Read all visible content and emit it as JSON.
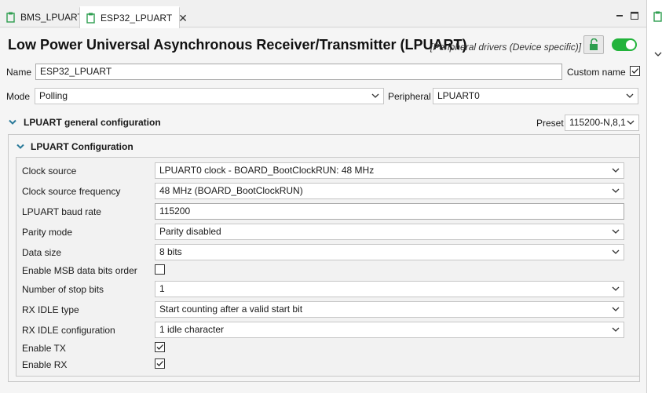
{
  "tabs": [
    {
      "label": "BMS_LPUART",
      "active": false
    },
    {
      "label": "ESP32_LPUART",
      "active": true
    }
  ],
  "header": {
    "title": "Low Power Universal Asynchronous Receiver/Transmitter (LPUART)",
    "subtitle": "[Peripheral drivers (Device specific)]",
    "enabled": true
  },
  "name_field": {
    "label": "Name",
    "value": "ESP32_LPUART"
  },
  "custom_name": {
    "label": "Custom name",
    "checked": true
  },
  "mode": {
    "label": "Mode",
    "value": "Polling"
  },
  "peripheral": {
    "label": "Peripheral",
    "value": "LPUART0"
  },
  "general_section": {
    "label": "LPUART general configuration"
  },
  "preset": {
    "label": "Preset",
    "value": "115200-N,8,1"
  },
  "config_section": {
    "label": "LPUART Configuration"
  },
  "settings": [
    {
      "label": "Clock source",
      "value": "LPUART0 clock - BOARD_BootClockRUN: 48 MHz",
      "kind": "select"
    },
    {
      "label": "Clock source frequency",
      "value": "48 MHz (BOARD_BootClockRUN)",
      "kind": "select"
    },
    {
      "label": "LPUART baud rate",
      "value": "115200",
      "kind": "text"
    },
    {
      "label": "Parity mode",
      "value": "Parity disabled",
      "kind": "select"
    },
    {
      "label": "Data size",
      "value": "8 bits",
      "kind": "select"
    },
    {
      "label": "Enable MSB data bits order",
      "checked": false,
      "kind": "check"
    },
    {
      "label": "Number of stop bits",
      "value": "1",
      "kind": "select"
    },
    {
      "label": "RX IDLE type",
      "value": "Start counting after a valid start bit",
      "kind": "select"
    },
    {
      "label": "RX IDLE configuration",
      "value": "1 idle character",
      "kind": "select"
    },
    {
      "label": "Enable TX",
      "checked": true,
      "kind": "check"
    },
    {
      "label": "Enable RX",
      "checked": true,
      "kind": "check"
    }
  ],
  "colors": {
    "toggle_on": "#22b33b",
    "icon_green": "#2e9e4f"
  }
}
